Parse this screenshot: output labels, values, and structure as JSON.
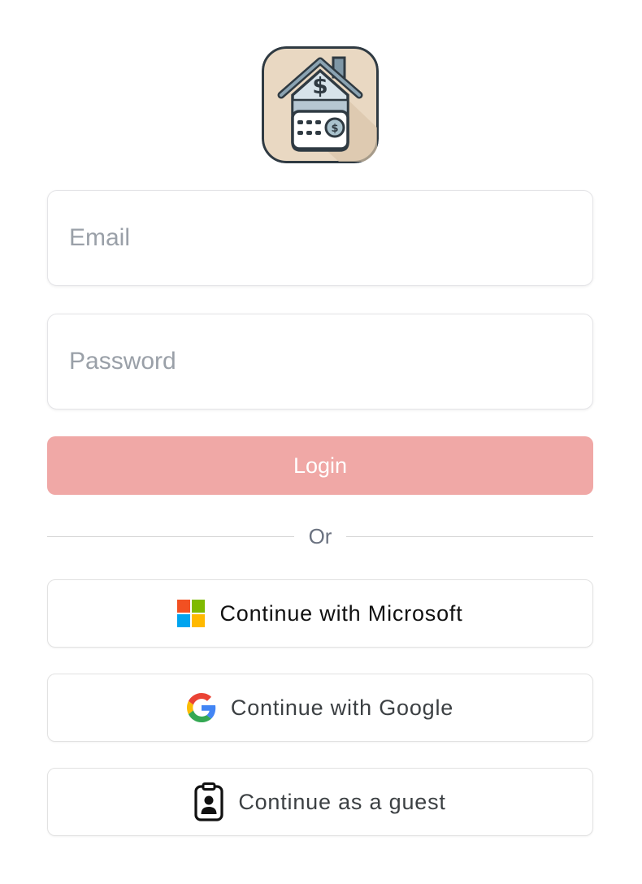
{
  "logo": {
    "icon": "house-calculator-dollar-icon"
  },
  "form": {
    "email_placeholder": "Email",
    "email_value": "",
    "password_placeholder": "Password",
    "password_value": "",
    "login_label": "Login"
  },
  "divider": {
    "label": "Or"
  },
  "oauth": {
    "microsoft_label": "Continue with Microsoft",
    "google_label": "Continue with Google",
    "guest_label": "Continue as a guest"
  },
  "colors": {
    "login_button": "#f0a8a6",
    "login_text": "#ffffff",
    "placeholder": "#9aa0a8",
    "divider_text": "#6b7280",
    "border": "#e4e4e7"
  }
}
